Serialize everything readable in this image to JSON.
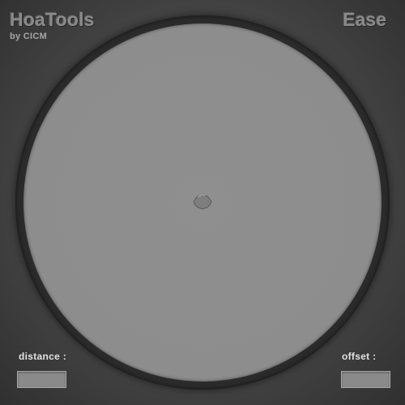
{
  "header": {
    "title": "HoaTools",
    "subtitle": "by CICM",
    "mode": "Ease"
  },
  "fields": {
    "distance_label": "distance :",
    "distance_value": "",
    "offset_label": "offset :",
    "offset_value": ""
  },
  "colors": {
    "background": "#4c4c4c",
    "ring": "#2b2b2b",
    "pad": "#8d8d8d",
    "title_text": "#8a8a8a",
    "label_text": "#e2e2e2",
    "field_fill": "#8a8a8a"
  },
  "icons": {
    "handle": "source-handle-icon"
  }
}
